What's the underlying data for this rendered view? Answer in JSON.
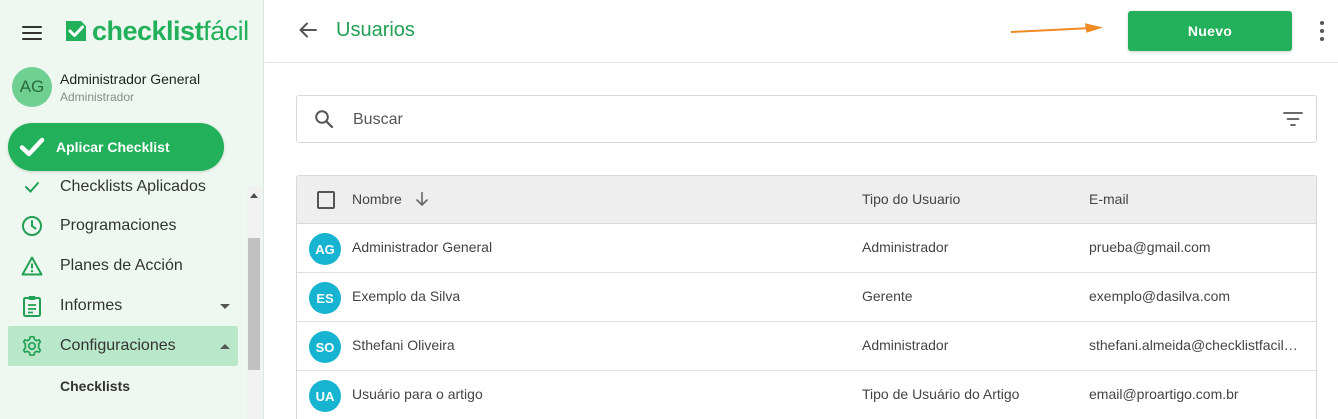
{
  "brand": {
    "logo_bold": "checklist",
    "logo_thin": "fácil",
    "color": "#22b05a"
  },
  "user": {
    "initials": "AG",
    "name": "Administrador General",
    "role": "Administrador"
  },
  "apply_button": {
    "label": "Aplicar Checklist"
  },
  "nav": {
    "items": [
      {
        "label": "Checklists Aplicados",
        "icon": "check-icon"
      },
      {
        "label": "Programaciones",
        "icon": "clock-icon"
      },
      {
        "label": "Planes de Acción",
        "icon": "warning-icon"
      },
      {
        "label": "Informes",
        "icon": "clipboard-icon"
      },
      {
        "label": "Configuraciones",
        "icon": "gear-icon"
      }
    ],
    "sub_items": [
      {
        "label": "Checklists"
      }
    ]
  },
  "header": {
    "title": "Usuarios",
    "new_button": "Nuevo",
    "annotation_arrow_color": "#f08a24"
  },
  "search": {
    "placeholder": "Buscar"
  },
  "table": {
    "columns": [
      "Nombre",
      "Tipo do Usuario",
      "E-mail"
    ],
    "rows": [
      {
        "initials": "AG",
        "name": "Administrador General",
        "type": "Administrador",
        "email": "prueba@gmail.com"
      },
      {
        "initials": "ES",
        "name": "Exemplo da Silva",
        "type": "Gerente",
        "email": "exemplo@dasilva.com"
      },
      {
        "initials": "SO",
        "name": "Sthefani Oliveira",
        "type": "Administrador",
        "email": "sthefani.almeida@checklistfacil.com"
      },
      {
        "initials": "UA",
        "name": "Usuário para o artigo",
        "type": "Tipo de Usuário do Artigo",
        "email": "email@proartigo.com.br"
      }
    ]
  }
}
